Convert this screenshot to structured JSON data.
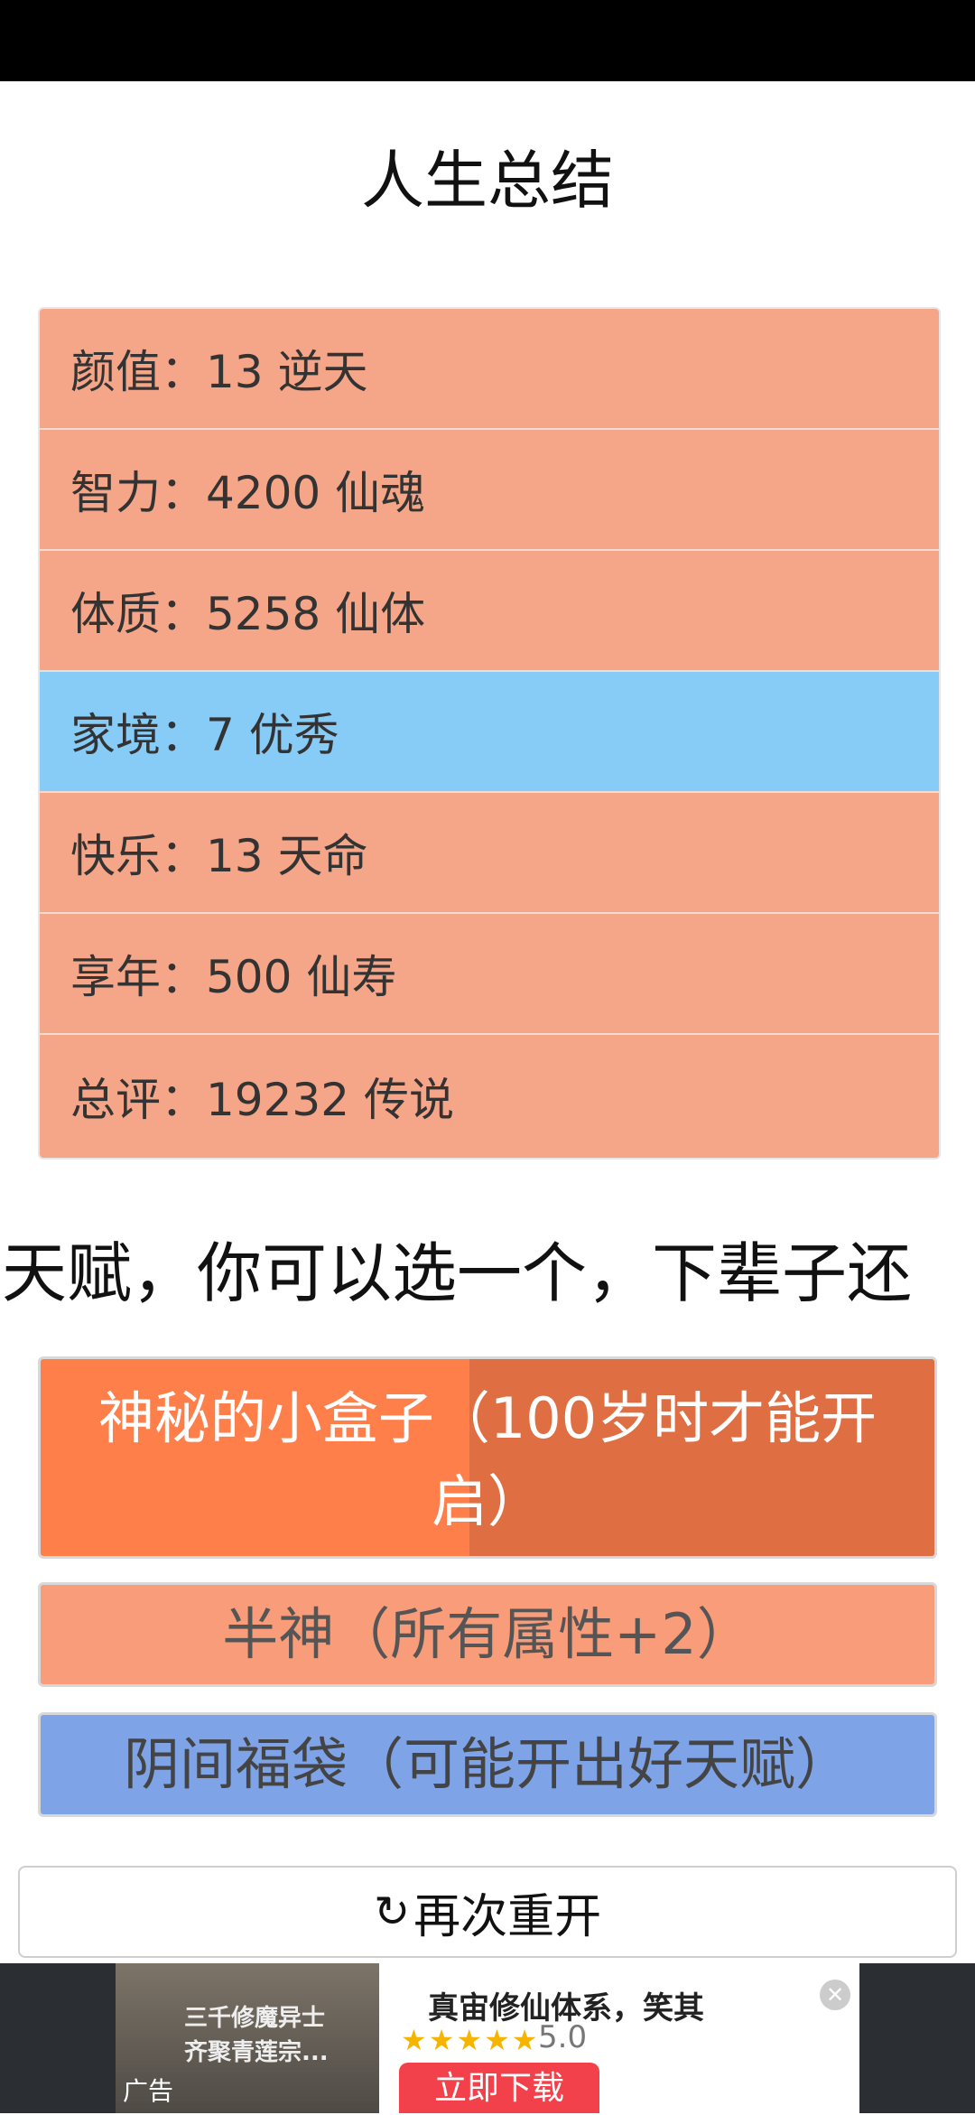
{
  "page_title": "人生总结",
  "stats": [
    {
      "label": "颜值：13 逆天",
      "style": "orange"
    },
    {
      "label": "智力：4200 仙魂",
      "style": "orange"
    },
    {
      "label": "体质：5258 仙体",
      "style": "orange"
    },
    {
      "label": "家境：7 优秀",
      "style": "blue"
    },
    {
      "label": "快乐：13 天命",
      "style": "orange"
    },
    {
      "label": "享年：500 仙寿",
      "style": "orange"
    },
    {
      "label": "总评：19232 传说",
      "style": "orange"
    }
  ],
  "talent_prompt": "天赋，你可以选一个，下辈子还",
  "talents": [
    {
      "label": "神秘的小盒子（100岁时才能开启）",
      "progress": 0.52
    },
    {
      "label": "半神（所有属性+2）"
    },
    {
      "label": "阴间福袋（可能开出好天赋）"
    }
  ],
  "restart_button": {
    "label": "再次重开",
    "icon": "refresh-icon"
  },
  "ad": {
    "thumb_line1": "三千修魔异士",
    "thumb_line2": "齐聚青莲宗...",
    "tag": "广告",
    "title": "真宙修仙体系，笑其",
    "stars": "★★★★★",
    "rating": "5.0",
    "download_label": "立即下载"
  },
  "colors": {
    "stat_orange": "#f6a688",
    "stat_blue": "#87cbf7",
    "talent_orange": "#ff7f4b",
    "talent_salmon": "#f89c7a",
    "talent_blue": "#7ea3e6",
    "download_red": "#f2414a"
  }
}
